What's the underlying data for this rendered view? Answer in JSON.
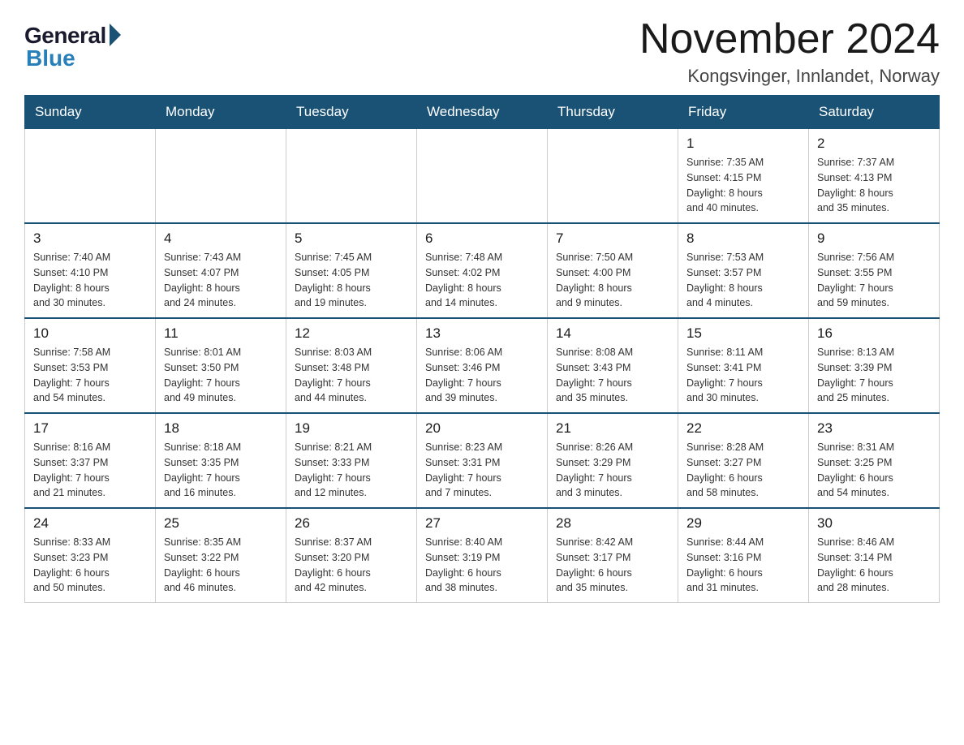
{
  "logo": {
    "general": "General",
    "blue": "Blue"
  },
  "title": "November 2024",
  "location": "Kongsvinger, Innlandet, Norway",
  "weekdays": [
    "Sunday",
    "Monday",
    "Tuesday",
    "Wednesday",
    "Thursday",
    "Friday",
    "Saturday"
  ],
  "weeks": [
    [
      {
        "day": "",
        "info": ""
      },
      {
        "day": "",
        "info": ""
      },
      {
        "day": "",
        "info": ""
      },
      {
        "day": "",
        "info": ""
      },
      {
        "day": "",
        "info": ""
      },
      {
        "day": "1",
        "info": "Sunrise: 7:35 AM\nSunset: 4:15 PM\nDaylight: 8 hours\nand 40 minutes."
      },
      {
        "day": "2",
        "info": "Sunrise: 7:37 AM\nSunset: 4:13 PM\nDaylight: 8 hours\nand 35 minutes."
      }
    ],
    [
      {
        "day": "3",
        "info": "Sunrise: 7:40 AM\nSunset: 4:10 PM\nDaylight: 8 hours\nand 30 minutes."
      },
      {
        "day": "4",
        "info": "Sunrise: 7:43 AM\nSunset: 4:07 PM\nDaylight: 8 hours\nand 24 minutes."
      },
      {
        "day": "5",
        "info": "Sunrise: 7:45 AM\nSunset: 4:05 PM\nDaylight: 8 hours\nand 19 minutes."
      },
      {
        "day": "6",
        "info": "Sunrise: 7:48 AM\nSunset: 4:02 PM\nDaylight: 8 hours\nand 14 minutes."
      },
      {
        "day": "7",
        "info": "Sunrise: 7:50 AM\nSunset: 4:00 PM\nDaylight: 8 hours\nand 9 minutes."
      },
      {
        "day": "8",
        "info": "Sunrise: 7:53 AM\nSunset: 3:57 PM\nDaylight: 8 hours\nand 4 minutes."
      },
      {
        "day": "9",
        "info": "Sunrise: 7:56 AM\nSunset: 3:55 PM\nDaylight: 7 hours\nand 59 minutes."
      }
    ],
    [
      {
        "day": "10",
        "info": "Sunrise: 7:58 AM\nSunset: 3:53 PM\nDaylight: 7 hours\nand 54 minutes."
      },
      {
        "day": "11",
        "info": "Sunrise: 8:01 AM\nSunset: 3:50 PM\nDaylight: 7 hours\nand 49 minutes."
      },
      {
        "day": "12",
        "info": "Sunrise: 8:03 AM\nSunset: 3:48 PM\nDaylight: 7 hours\nand 44 minutes."
      },
      {
        "day": "13",
        "info": "Sunrise: 8:06 AM\nSunset: 3:46 PM\nDaylight: 7 hours\nand 39 minutes."
      },
      {
        "day": "14",
        "info": "Sunrise: 8:08 AM\nSunset: 3:43 PM\nDaylight: 7 hours\nand 35 minutes."
      },
      {
        "day": "15",
        "info": "Sunrise: 8:11 AM\nSunset: 3:41 PM\nDaylight: 7 hours\nand 30 minutes."
      },
      {
        "day": "16",
        "info": "Sunrise: 8:13 AM\nSunset: 3:39 PM\nDaylight: 7 hours\nand 25 minutes."
      }
    ],
    [
      {
        "day": "17",
        "info": "Sunrise: 8:16 AM\nSunset: 3:37 PM\nDaylight: 7 hours\nand 21 minutes."
      },
      {
        "day": "18",
        "info": "Sunrise: 8:18 AM\nSunset: 3:35 PM\nDaylight: 7 hours\nand 16 minutes."
      },
      {
        "day": "19",
        "info": "Sunrise: 8:21 AM\nSunset: 3:33 PM\nDaylight: 7 hours\nand 12 minutes."
      },
      {
        "day": "20",
        "info": "Sunrise: 8:23 AM\nSunset: 3:31 PM\nDaylight: 7 hours\nand 7 minutes."
      },
      {
        "day": "21",
        "info": "Sunrise: 8:26 AM\nSunset: 3:29 PM\nDaylight: 7 hours\nand 3 minutes."
      },
      {
        "day": "22",
        "info": "Sunrise: 8:28 AM\nSunset: 3:27 PM\nDaylight: 6 hours\nand 58 minutes."
      },
      {
        "day": "23",
        "info": "Sunrise: 8:31 AM\nSunset: 3:25 PM\nDaylight: 6 hours\nand 54 minutes."
      }
    ],
    [
      {
        "day": "24",
        "info": "Sunrise: 8:33 AM\nSunset: 3:23 PM\nDaylight: 6 hours\nand 50 minutes."
      },
      {
        "day": "25",
        "info": "Sunrise: 8:35 AM\nSunset: 3:22 PM\nDaylight: 6 hours\nand 46 minutes."
      },
      {
        "day": "26",
        "info": "Sunrise: 8:37 AM\nSunset: 3:20 PM\nDaylight: 6 hours\nand 42 minutes."
      },
      {
        "day": "27",
        "info": "Sunrise: 8:40 AM\nSunset: 3:19 PM\nDaylight: 6 hours\nand 38 minutes."
      },
      {
        "day": "28",
        "info": "Sunrise: 8:42 AM\nSunset: 3:17 PM\nDaylight: 6 hours\nand 35 minutes."
      },
      {
        "day": "29",
        "info": "Sunrise: 8:44 AM\nSunset: 3:16 PM\nDaylight: 6 hours\nand 31 minutes."
      },
      {
        "day": "30",
        "info": "Sunrise: 8:46 AM\nSunset: 3:14 PM\nDaylight: 6 hours\nand 28 minutes."
      }
    ]
  ]
}
